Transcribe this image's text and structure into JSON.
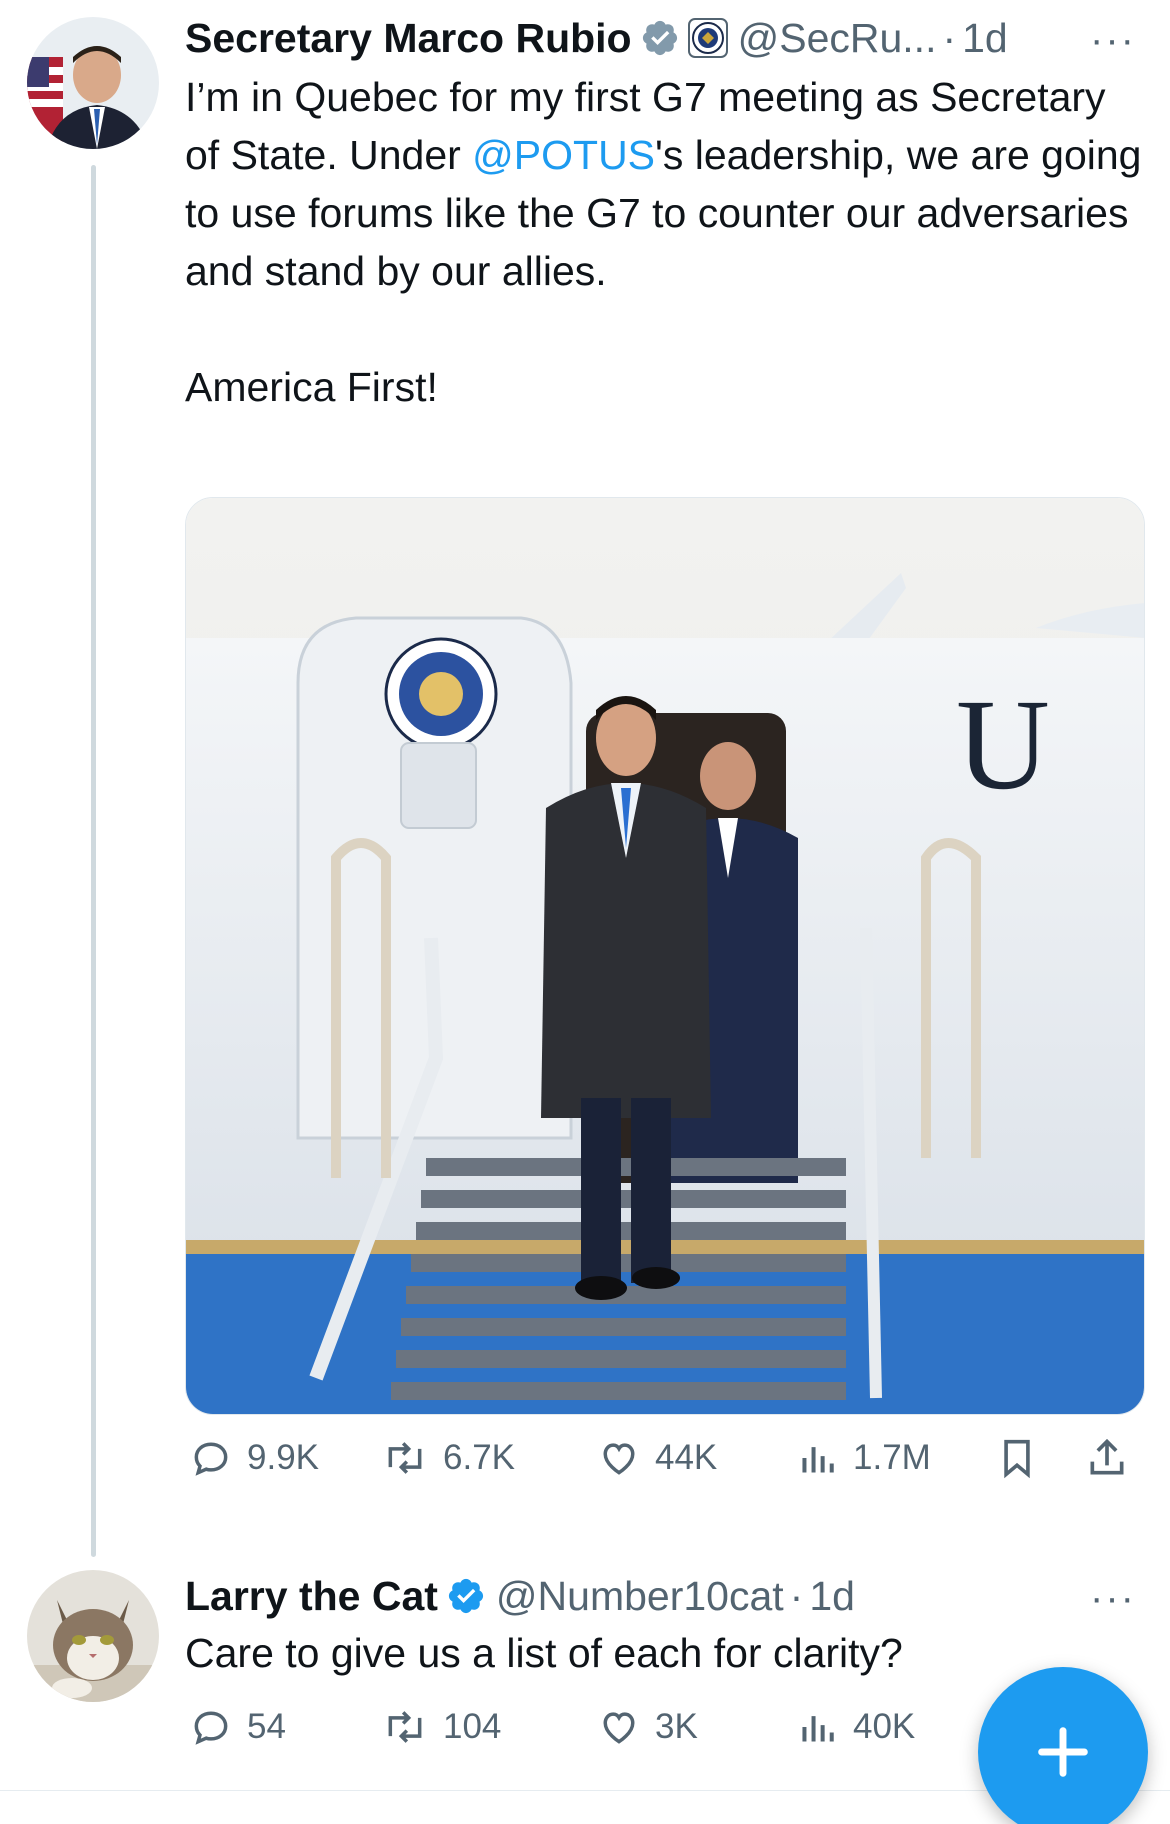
{
  "tweet1": {
    "author_name": "Secretary Marco Rubio",
    "handle": "@SecRu...",
    "separator": "·",
    "time": "1d",
    "more": "···",
    "text_before_mention": "I’m in Quebec for my first G7 meeting as Secretary of State. Under ",
    "mention": "@POTUS",
    "text_after_mention": "'s leadership, we are going to use forums like the G7 to counter our adversaries and stand by our allies.\n\nAmerica First!",
    "actions": {
      "replies": "9.9K",
      "reposts": "6.7K",
      "likes": "44K",
      "views": "1.7M"
    }
  },
  "tweet2": {
    "author_name": "Larry the Cat",
    "handle": "@Number10cat",
    "separator": "·",
    "time": "1d",
    "more": "···",
    "text": "Care to give us a list of each for clarity?",
    "actions": {
      "replies": "54",
      "reposts": "104",
      "likes": "3K",
      "views": "40K"
    }
  },
  "colors": {
    "accent": "#1d9bf0",
    "muted": "#536471",
    "text": "#0f1419",
    "thread_line": "#cfd9de"
  },
  "icons": [
    "verified-badge-icon",
    "state-department-seal-icon",
    "reply-icon",
    "repost-icon",
    "like-icon",
    "views-icon",
    "bookmark-icon",
    "share-icon",
    "plus-icon"
  ]
}
